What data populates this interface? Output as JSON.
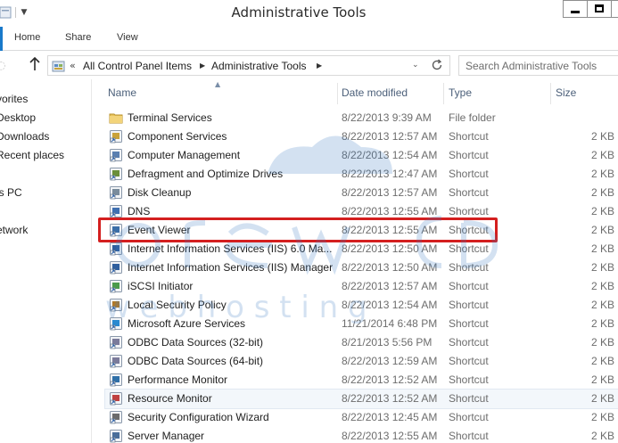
{
  "window": {
    "title": "Administrative Tools"
  },
  "ribbon": {
    "tabs": [
      {
        "label": "Home"
      },
      {
        "label": "Share"
      },
      {
        "label": "View"
      }
    ]
  },
  "address": {
    "overflow": "«",
    "crumbs": [
      "All Control Panel Items",
      "Administrative Tools"
    ],
    "search_placeholder": "Search Administrative Tools"
  },
  "nav": {
    "items": [
      "vorites",
      "Desktop",
      "Downloads",
      "Recent places",
      "is PC",
      "etwork"
    ]
  },
  "columns": {
    "name": "Name",
    "date": "Date modified",
    "type": "Type",
    "size": "Size"
  },
  "files": [
    {
      "name": "Terminal Services",
      "date": "8/22/2013 9:39 AM",
      "type": "File folder",
      "size": "",
      "icon": "folder-icon"
    },
    {
      "name": "Component Services",
      "date": "8/22/2013 12:57 AM",
      "type": "Shortcut",
      "size": "2 KB",
      "icon": "component-services-icon"
    },
    {
      "name": "Computer Management",
      "date": "8/22/2013 12:54 AM",
      "type": "Shortcut",
      "size": "2 KB",
      "icon": "computer-management-icon"
    },
    {
      "name": "Defragment and Optimize Drives",
      "date": "8/22/2013 12:47 AM",
      "type": "Shortcut",
      "size": "2 KB",
      "icon": "defragment-icon"
    },
    {
      "name": "Disk Cleanup",
      "date": "8/22/2013 12:57 AM",
      "type": "Shortcut",
      "size": "2 KB",
      "icon": "disk-cleanup-icon"
    },
    {
      "name": "DNS",
      "date": "8/22/2013 12:55 AM",
      "type": "Shortcut",
      "size": "2 KB",
      "icon": "dns-icon"
    },
    {
      "name": "Event Viewer",
      "date": "8/22/2013 12:55 AM",
      "type": "Shortcut",
      "size": "2 KB",
      "icon": "event-viewer-icon"
    },
    {
      "name": "Internet Information Services (IIS) 6.0 Ma...",
      "date": "8/22/2013 12:50 AM",
      "type": "Shortcut",
      "size": "2 KB",
      "icon": "iis6-icon"
    },
    {
      "name": "Internet Information Services (IIS) Manager",
      "date": "8/22/2013 12:50 AM",
      "type": "Shortcut",
      "size": "2 KB",
      "icon": "iis-manager-icon"
    },
    {
      "name": "iSCSI Initiator",
      "date": "8/22/2013 12:57 AM",
      "type": "Shortcut",
      "size": "2 KB",
      "icon": "iscsi-icon"
    },
    {
      "name": "Local Security Policy",
      "date": "8/22/2013 12:54 AM",
      "type": "Shortcut",
      "size": "2 KB",
      "icon": "security-policy-icon"
    },
    {
      "name": "Microsoft Azure Services",
      "date": "11/21/2014 6:48 PM",
      "type": "Shortcut",
      "size": "2 KB",
      "icon": "azure-icon"
    },
    {
      "name": "ODBC Data Sources (32-bit)",
      "date": "8/21/2013 5:56 PM",
      "type": "Shortcut",
      "size": "2 KB",
      "icon": "odbc-icon"
    },
    {
      "name": "ODBC Data Sources (64-bit)",
      "date": "8/22/2013 12:59 AM",
      "type": "Shortcut",
      "size": "2 KB",
      "icon": "odbc-icon"
    },
    {
      "name": "Performance Monitor",
      "date": "8/22/2013 12:52 AM",
      "type": "Shortcut",
      "size": "2 KB",
      "icon": "performance-monitor-icon"
    },
    {
      "name": "Resource Monitor",
      "date": "8/22/2013 12:52 AM",
      "type": "Shortcut",
      "size": "2 KB",
      "icon": "resource-monitor-icon"
    },
    {
      "name": "Security Configuration Wizard",
      "date": "8/22/2013 12:45 AM",
      "type": "Shortcut",
      "size": "2 KB",
      "icon": "security-wizard-icon"
    },
    {
      "name": "Server Manager",
      "date": "8/22/2013 12:55 AM",
      "type": "Shortcut",
      "size": "2 KB",
      "icon": "server-manager-icon"
    }
  ],
  "highlighted_file": "Event Viewer",
  "hovered_file": "Resource Monitor",
  "watermark": {
    "word1": "orew",
    "word2": "w e b   h o s t i n g",
    "color": "#3a7cc4"
  },
  "colors": {
    "highlight": "#d41f1f",
    "accent": "#1979ca"
  }
}
